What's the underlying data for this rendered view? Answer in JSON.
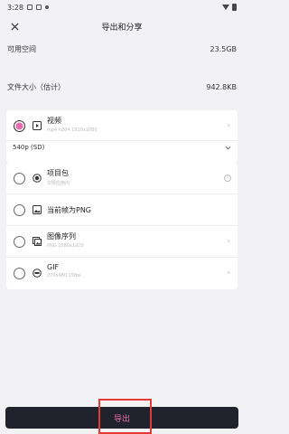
{
  "status": {
    "time": "3:28"
  },
  "header": {
    "title": "导出和分享"
  },
  "info": {
    "space_label": "可用空间",
    "space_value": "23.5GB",
    "size_label": "文件大小（估计）",
    "size_value": "942.8KB"
  },
  "options": [
    {
      "label": "视频",
      "sub": "mp4 h264 1920x1080",
      "selected": true,
      "icon": "play-icon"
    },
    {
      "label": "项目包",
      "sub": "仅限应用内",
      "selected": false,
      "icon": "package-icon"
    },
    {
      "label": "当前帧为PNG",
      "sub": "",
      "selected": false,
      "icon": "image-icon"
    },
    {
      "label": "图像序列",
      "sub": "PNG 1080x1920",
      "selected": false,
      "icon": "image-sequence-icon"
    },
    {
      "label": "GIF",
      "sub": "270x480 15fps",
      "selected": false,
      "icon": "gif-icon"
    }
  ],
  "resolution": {
    "value": "540p (SD)"
  },
  "export_button": {
    "label": "导出"
  },
  "colors": {
    "accent": "#e86ab0",
    "button_bg": "#20222c",
    "highlight": "#e53935"
  }
}
